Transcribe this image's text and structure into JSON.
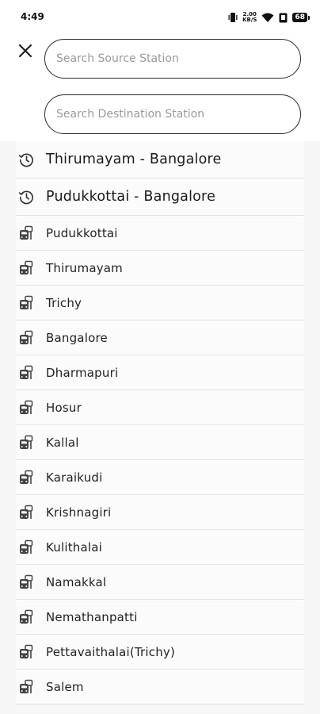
{
  "status_bar": {
    "time": "4:49",
    "speed_value": "2.00",
    "speed_unit": "KB/S",
    "battery": "68"
  },
  "search": {
    "source_placeholder": "Search Source Station",
    "destination_placeholder": "Search Destination Station"
  },
  "recent_searches": [
    {
      "label": "Thirumayam - Bangalore",
      "icon": "history-icon"
    },
    {
      "label": "Pudukkottai - Bangalore",
      "icon": "history-icon"
    }
  ],
  "stations": [
    {
      "label": "Pudukkottai",
      "icon": "bus-stop-icon"
    },
    {
      "label": "Thirumayam",
      "icon": "bus-stop-icon"
    },
    {
      "label": "Trichy",
      "icon": "bus-stop-icon"
    },
    {
      "label": "Bangalore",
      "icon": "bus-stop-icon"
    },
    {
      "label": "Dharmapuri",
      "icon": "bus-stop-icon"
    },
    {
      "label": "Hosur",
      "icon": "bus-stop-icon"
    },
    {
      "label": "Kallal",
      "icon": "bus-stop-icon"
    },
    {
      "label": "Karaikudi",
      "icon": "bus-stop-icon"
    },
    {
      "label": "Krishnagiri",
      "icon": "bus-stop-icon"
    },
    {
      "label": "Kulithalai",
      "icon": "bus-stop-icon"
    },
    {
      "label": "Namakkal",
      "icon": "bus-stop-icon"
    },
    {
      "label": "Nemathanpatti",
      "icon": "bus-stop-icon"
    },
    {
      "label": "Pettavaithalai(Trichy)",
      "icon": "bus-stop-icon"
    },
    {
      "label": "Salem",
      "icon": "bus-stop-icon"
    }
  ],
  "colors": {
    "text": "#1c1c1c",
    "placeholder": "#9a9a9a",
    "list_background": "#f6f6f7",
    "divider": "#e4e4e6"
  }
}
